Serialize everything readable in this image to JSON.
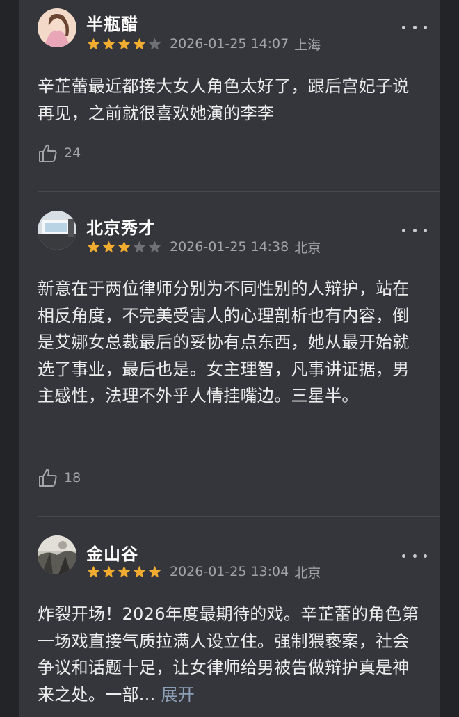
{
  "reviews": [
    {
      "username": "半瓶醋",
      "rating": 4,
      "date": "2026-01-25 14:07",
      "location": "上海",
      "text": "辛芷蕾最近都接大女人角色太好了，跟后宫妃子说再见，之前就很喜欢她演的李李",
      "likes": "24",
      "expand_label": ""
    },
    {
      "username": "北京秀才",
      "rating": 3,
      "date": "2026-01-25 14:38",
      "location": "北京",
      "text": "新意在于两位律师分别为不同性别的人辩护，站在相反角度，不完美受害人的心理剖析也有内容，倒是艾娜女总裁最后的妥协有点东西，她从最开始就选了事业，最后也是。女主理智，凡事讲证据，男主感性，法理不外乎人情挂嘴边。三星半。",
      "likes": "18",
      "expand_label": ""
    },
    {
      "username": "金山谷",
      "rating": 5,
      "date": "2026-01-25 13:04",
      "location": "北京",
      "text": "炸裂开场！2026年度最期待的戏。辛芷蕾的角色第一场戏直接气质拉满人设立住。强制猥亵案，社会争议和话题十足，让女律师给男被告做辩护真是神来之处。一部...",
      "likes": "",
      "expand_label": "展开"
    }
  ],
  "icons": {
    "star": "star-icon",
    "more": "more-icon",
    "like": "thumbs-up-icon"
  },
  "colors": {
    "star_filled": "#f2ad31",
    "star_empty": "#6f7075",
    "expand_link": "#8e9fb8",
    "panel_bg": "#35363b"
  }
}
